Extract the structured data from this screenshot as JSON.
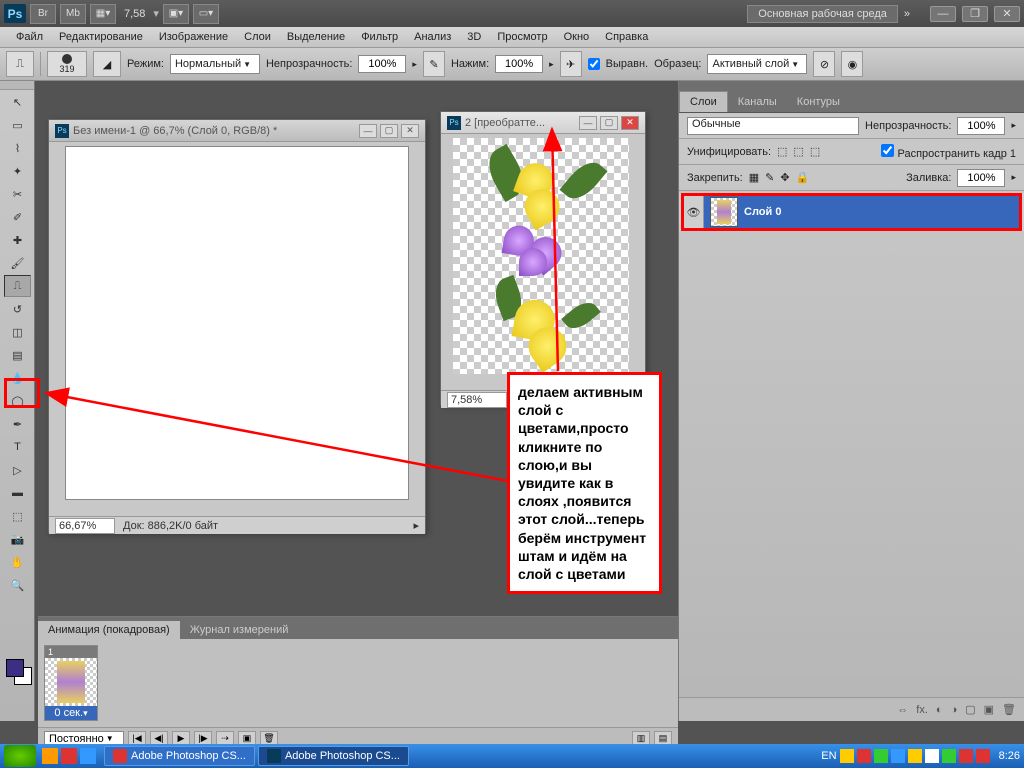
{
  "titlebar": {
    "zoom_num": "7,58",
    "workspace": "Основная рабочая среда"
  },
  "menu": [
    "Файл",
    "Редактирование",
    "Изображение",
    "Слои",
    "Выделение",
    "Фильтр",
    "Анализ",
    "3D",
    "Просмотр",
    "Окно",
    "Справка"
  ],
  "optbar": {
    "brush_size": "319",
    "mode_label": "Режим:",
    "mode_val": "Нормальный",
    "opacity_label": "Непрозрачность:",
    "opacity_val": "100%",
    "flow_label": "Нажим:",
    "flow_val": "100%",
    "aligned": "Выравн.",
    "sample_label": "Образец:",
    "sample_val": "Активный слой"
  },
  "doc1": {
    "title": "Без имени-1 @ 66,7% (Слой 0, RGB/8) *",
    "zoom": "66,67%",
    "status": "Док: 886,2K/0 байт"
  },
  "doc2": {
    "title": "2 [преобратте...",
    "zoom": "7,58%"
  },
  "layers": {
    "tabs": [
      "Слои",
      "Каналы",
      "Контуры"
    ],
    "blend": "Обычные",
    "opacity_label": "Непрозрачность:",
    "opacity": "100%",
    "unify": "Унифицировать:",
    "propagate": "Распространить кадр 1",
    "lock": "Закрепить:",
    "fill_label": "Заливка:",
    "fill": "100%",
    "layer0": "Слой 0"
  },
  "anim": {
    "tabs": [
      "Анимация (покадровая)",
      "Журнал измерений"
    ],
    "frame_num": "1",
    "frame_time": "0 сек.",
    "loop": "Постоянно"
  },
  "annot_text": "делаем активным слой с цветами,просто кликните по слою,и вы увидите как в слоях ,появится этот слой...теперь берём инструмент штам и идём на слой с цветами",
  "taskbar": {
    "task1": "Adobe Photoshop CS...",
    "task2": "Adobe Photoshop CS...",
    "lang": "EN",
    "time": "8:26"
  }
}
